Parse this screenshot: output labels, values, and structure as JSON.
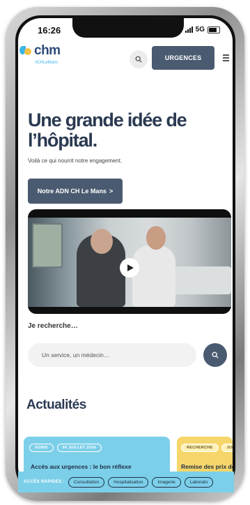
{
  "status_bar": {
    "time": "16:26",
    "network": "5G"
  },
  "header": {
    "logo_text": "chm",
    "logo_sub": "#CHLeMans",
    "urgences_label": "URGENCES"
  },
  "hero": {
    "title_line1": "Une grande idée de",
    "title_line2": "l’hôpital.",
    "subtitle": "Voilà ce qui nourrit notre engagement.",
    "cta_label": "Notre ADN CH Le Mans",
    "cta_chevron": ">"
  },
  "search": {
    "label": "Je recherche…",
    "placeholder": "Un service, un médecin…"
  },
  "news": {
    "title": "Actualités",
    "cards": [
      {
        "tag1": "SOINS",
        "tag2": "04 JUILLET 2024",
        "headline": "Accès aux urgences : le bon réflexe"
      },
      {
        "tag1": "RECHERCHE",
        "tag2": "JUI",
        "headline": "Remise des prix de"
      }
    ]
  },
  "quick_access": {
    "label": "ACCÈS RAPIDES :",
    "chips": [
      "Consultation",
      "Hospitalisation",
      "Imagerie",
      "Laborato"
    ]
  },
  "colors": {
    "primary_dark": "#4a5a70",
    "title_navy": "#2b3a52",
    "accent_blue": "#7ccfe9",
    "accent_yellow": "#f6d66a"
  }
}
